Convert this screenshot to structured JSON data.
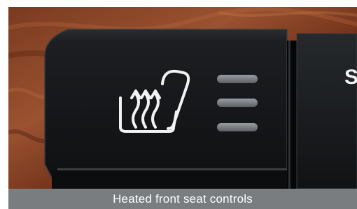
{
  "caption": "Heated front seat controls",
  "panel": {
    "button_label_partial": "S",
    "heat_level_indicators": 3
  },
  "colors": {
    "wood_dark": "#5a2414",
    "wood_mid": "#8e4a2a",
    "wood_light": "#b86a40",
    "panel_black": "#141618",
    "icon_white": "#f2f2f2",
    "indicator_grey": "#7c8084",
    "caption_bg": "#7a7d80"
  },
  "icons": [
    "seat-heater-icon"
  ]
}
